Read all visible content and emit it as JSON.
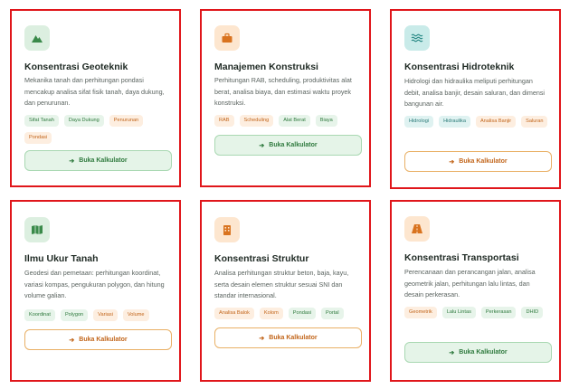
{
  "button_label": "Buka Kalkulator",
  "cards": [
    {
      "title": "Konsentrasi Geoteknik",
      "icon": "mountain-icon",
      "description": "Mekanika tanah dan perhitungan pondasi mencakup analisa sifat fisik tanah, daya dukung, dan penurunan.",
      "tags": [
        "Sifat Tanah",
        "Daya Dukung",
        "Penurunan",
        "Pondasi"
      ]
    },
    {
      "title": "Manajemen Konstruksi",
      "icon": "toolbox-icon",
      "description": "Perhitungan RAB, scheduling, produktivitas alat berat, analisa biaya, dan estimasi waktu proyek konstruksi.",
      "tags": [
        "RAB",
        "Scheduling",
        "Alat Berat",
        "Biaya"
      ]
    },
    {
      "title": "Konsentrasi Hidroteknik",
      "icon": "water-icon",
      "description": "Hidrologi dan hidraulika meliputi perhitungan debit, analisa banjir, desain saluran, dan dimensi bangunan air.",
      "tags": [
        "Hidrologi",
        "Hidraulika",
        "Analisa Banjir",
        "Saluran"
      ]
    },
    {
      "title": "Ilmu Ukur Tanah",
      "icon": "map-icon",
      "description": "Geodesi dan pemetaan: perhitungan koordinat, variasi kompas, pengukuran polygon, dan hitung volume galian.",
      "tags": [
        "Koordinat",
        "Polygon",
        "Variasi",
        "Volume"
      ]
    },
    {
      "title": "Konsentrasi Struktur",
      "icon": "building-icon",
      "description": "Analisa perhitungan struktur beton, baja, kayu, serta desain elemen struktur sesuai SNI dan standar internasional.",
      "tags": [
        "Analisa Balok",
        "Kolom",
        "Pondasi",
        "Portal"
      ]
    },
    {
      "title": "Konsentrasi Transportasi",
      "icon": "road-icon",
      "description": "Perencanaan dan perancangan jalan, analisa geometrik jalan, perhitungan lalu lintas, dan desain perkerasan.",
      "tags": [
        "Geometrik",
        "Lalu Lintas",
        "Perkerasan",
        "DHID"
      ]
    }
  ],
  "colors": {
    "card_border": "#e0161b",
    "green": "#2f7a3e",
    "orange": "#c2651a",
    "teal": "#2a7a78"
  }
}
